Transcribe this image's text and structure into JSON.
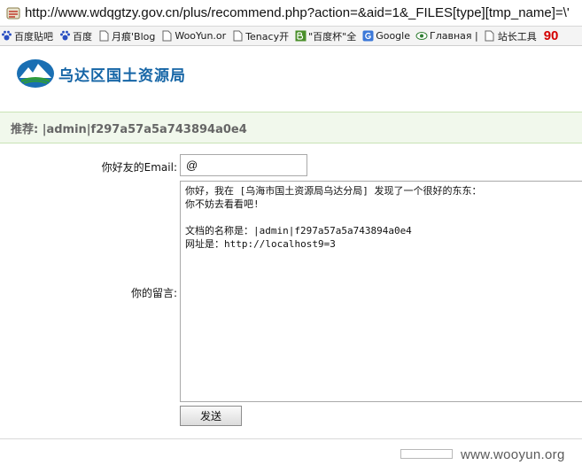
{
  "browser": {
    "url": "http://www.wdqgtzy.gov.cn/plus/recommend.php?action=&aid=1&_FILES[type][tmp_name]=\\'",
    "bookmarks": [
      {
        "label": "百度贴吧",
        "icon": "paw-icon"
      },
      {
        "label": "百度",
        "icon": "paw-icon"
      },
      {
        "label": "月痕'Blog",
        "icon": "page-icon"
      },
      {
        "label": "WooYun.or",
        "icon": "page-icon"
      },
      {
        "label": "Tenacy开",
        "icon": "page-icon"
      },
      {
        "label": "\"百度杯\"全",
        "icon": "bc-icon"
      },
      {
        "label": "Google",
        "icon": "google-icon"
      },
      {
        "label": "Главная |",
        "icon": "eye-icon"
      },
      {
        "label": "站长工具",
        "icon": "page-icon"
      }
    ],
    "bookmark_extra": "90"
  },
  "header": {
    "logo_text": "乌达区国土资源局"
  },
  "recommend": {
    "text": "推荐: |admin|f297a57a5a743894a0e4"
  },
  "form": {
    "email_label": "你好友的Email:",
    "email_value": "@",
    "message_label": "你的留言:",
    "message_value": "你好，我在 [乌海市国土资源局乌达分局] 发现了一个很好的东东：\n你不妨去看看吧!\n\n文档的名称是：|admin|f297a57a5a743894a0e4\n网址是：http://localhost9=3",
    "submit_label": "发送"
  },
  "watermark": "www.wooyun.org",
  "colors": {
    "recommend_bg": "#f1f8ec",
    "recommend_border": "#c9e3b5",
    "logo_blue": "#1565a6",
    "bookmark_extra_red": "#d40000"
  }
}
